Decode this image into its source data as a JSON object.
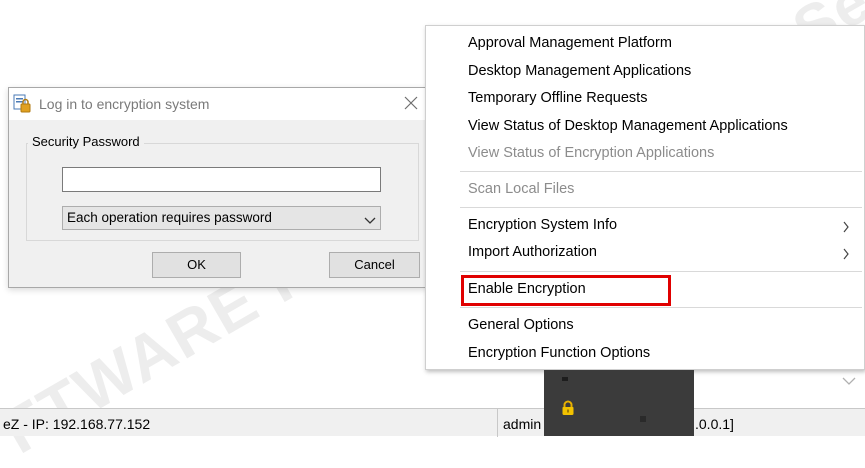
{
  "watermark": {
    "main": "FTWARE PTE. LTD",
    "top": "AnySe"
  },
  "dialog": {
    "title": "Log in to encryption system",
    "group_label": "Security Password",
    "password_value": "",
    "mode_selected": "Each operation requires password",
    "ok_label": "OK",
    "cancel_label": "Cancel"
  },
  "menu": {
    "items": [
      {
        "label": "Approval Management Platform",
        "enabled": true
      },
      {
        "label": "Desktop Management Applications",
        "enabled": true
      },
      {
        "label": "Temporary Offline Requests",
        "enabled": true
      },
      {
        "label": "View Status of Desktop Management Applications",
        "enabled": true
      },
      {
        "label": "View Status of Encryption Applications",
        "enabled": false
      },
      {
        "label": "Scan Local Files",
        "enabled": false
      },
      {
        "label": "Encryption System Info",
        "enabled": true,
        "submenu": true
      },
      {
        "label": "Import Authorization",
        "enabled": true,
        "submenu": true
      },
      {
        "label": "Enable Encryption",
        "enabled": true,
        "highlighted": true
      },
      {
        "label": "General Options",
        "enabled": true
      },
      {
        "label": "Encryption Function Options",
        "enabled": true
      }
    ],
    "highlight_color": "#e00000"
  },
  "statusbar": {
    "ip_text": "eZ - IP: 192.168.77.152",
    "user_text": "admin",
    "addr_text": ".0.0.1]"
  }
}
